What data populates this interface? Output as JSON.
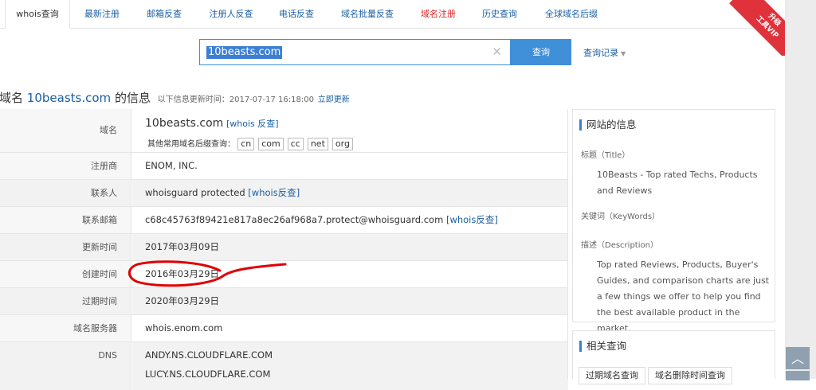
{
  "nav": {
    "tabs": [
      {
        "label": "whois查询"
      },
      {
        "label": "最新注册"
      },
      {
        "label": "邮箱反查"
      },
      {
        "label": "注册人反查"
      },
      {
        "label": "电话反查"
      },
      {
        "label": "域名批量反查"
      },
      {
        "label": "域名注册"
      },
      {
        "label": "历史查询"
      },
      {
        "label": "全球域名后缀"
      }
    ],
    "ribbon_line1": "升级",
    "ribbon_line2": "工具VIP"
  },
  "search": {
    "value": "10beasts.com",
    "button_label": "查询",
    "history_label": "查询记录"
  },
  "heading": {
    "prefix": "域名",
    "domain": "10beasts.com",
    "suffix": "的信息",
    "updated": "以下信息更新时间：2017-07-17 16:18:00",
    "refresh_link": "立即更新"
  },
  "info": {
    "domain_label": "域名",
    "domain_value": "10beasts.com",
    "whois_reverse": "[whois 反查]",
    "suffix_label": "其他常用域名后缀查询：",
    "suffixes": [
      "cn",
      "com",
      "cc",
      "net",
      "org"
    ],
    "registrar_label": "注册商",
    "registrar_value": "ENOM, INC.",
    "contact_label": "联系人",
    "contact_value": "whoisguard protected",
    "contact_link": "[whois反查]",
    "email_label": "联系邮箱",
    "email_value": "c68c45763f89421e817a8ec26af968a7.protect@whoisguard.com",
    "email_link": "[whois反查]",
    "updated_label": "更新时间",
    "updated_value": "2017年03月09日",
    "created_label": "创建时间",
    "created_value": "2016年03月29日",
    "expires_label": "过期时间",
    "expires_value": "2020年03月29日",
    "server_label": "域名服务器",
    "server_value": "whois.enom.com",
    "dns_label": "DNS",
    "dns_values": [
      "ANDY.NS.CLOUDFLARE.COM",
      "LUCY.NS.CLOUDFLARE.COM"
    ]
  },
  "site_info": {
    "title": "网站的信息",
    "title_label": "标题（Title）",
    "title_value": "10Beasts - Top rated Techs, Products and Reviews",
    "keywords_label": "关键词（KeyWords）",
    "description_label": "描述（Description）",
    "description_value": "Top rated Reviews, Products, Buyer's Guides, and comparison charts are just a few things we offer to help you find the best available product in the market."
  },
  "related": {
    "title": "相关查询",
    "buttons": [
      "过期域名查询",
      "域名删除时间查询"
    ]
  },
  "colors": {
    "accent": "#3f8fd9",
    "link": "#1a5fa5",
    "annotation": "#e00000",
    "ribbon": "#e0323b"
  }
}
